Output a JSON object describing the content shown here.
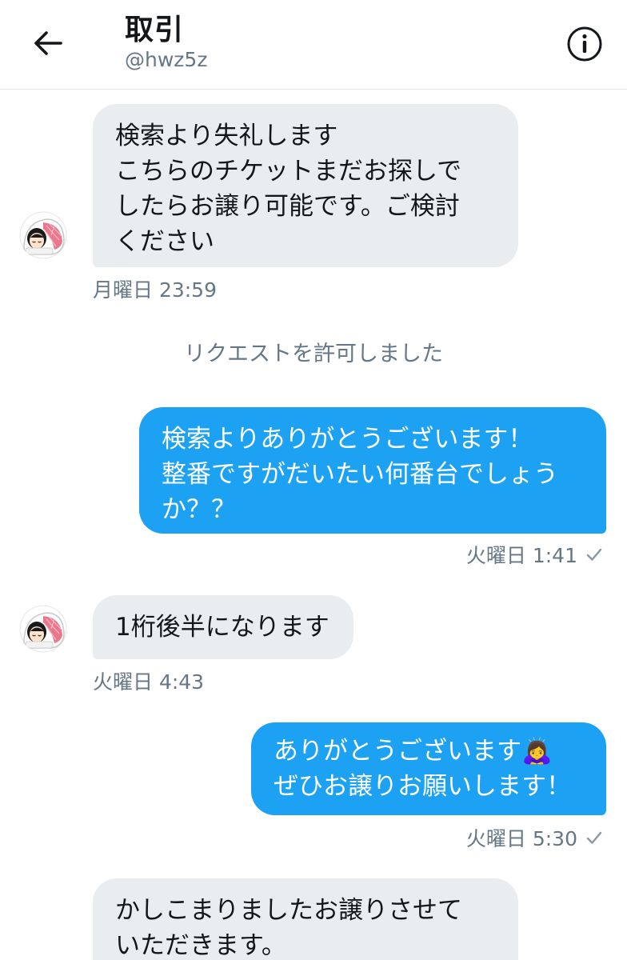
{
  "header": {
    "title": "取引",
    "handle": "@hwz5z",
    "back_icon": "arrow-left-icon",
    "info_icon": "info-circle-icon"
  },
  "messages": [
    {
      "direction": "in",
      "text": "検索より失礼します\nこちらのチケットまだお探しで\nしたらお譲り可能です。ご検討\nください",
      "time": "月曜日 23:59"
    },
    {
      "direction": "system",
      "text": "リクエストを許可しました"
    },
    {
      "direction": "out",
      "text": "検索よりありがとうございます！\n整番ですがだいたい何番台でしょう\nか？？",
      "time": "火曜日 1:41"
    },
    {
      "direction": "in",
      "text": "1桁後半になります",
      "time": "火曜日 4:43"
    },
    {
      "direction": "out",
      "text": "ありがとうございます🙇‍♀️\nぜひお譲りお願いします！",
      "time": "火曜日 5:30"
    },
    {
      "direction": "in",
      "text": "かしこまりましたお譲りさせて\nいただきます。"
    }
  ],
  "colors": {
    "accent": "#1da1f2",
    "incoming_bubble": "#e9edf0",
    "secondary_text": "#657786"
  },
  "icons": {
    "read_receipt": "check-icon",
    "avatar": "sleeping-person-avatar-icon"
  }
}
